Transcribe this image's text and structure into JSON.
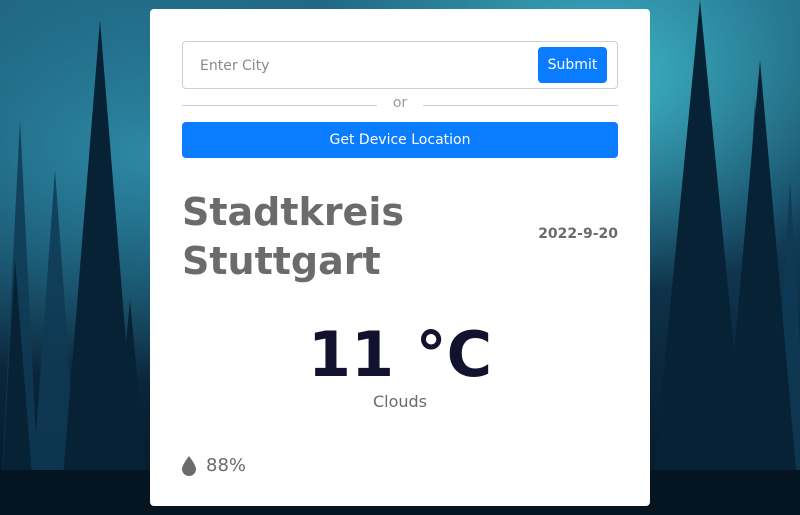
{
  "search": {
    "placeholder": "Enter City",
    "value": "",
    "submit_label": "Submit"
  },
  "divider": {
    "label": "or"
  },
  "location": {
    "button_label": "Get Device Location"
  },
  "weather": {
    "city": "Stadtkreis Stuttgart",
    "date": "2022-9-20",
    "temperature": "11 °C",
    "description": "Clouds",
    "humidity": "88%"
  },
  "colors": {
    "accent": "#0a7cff",
    "temperature_text": "#12122e",
    "secondary_text": "#6b6b6b"
  },
  "icons": {
    "humidity": "water-drop-icon"
  }
}
